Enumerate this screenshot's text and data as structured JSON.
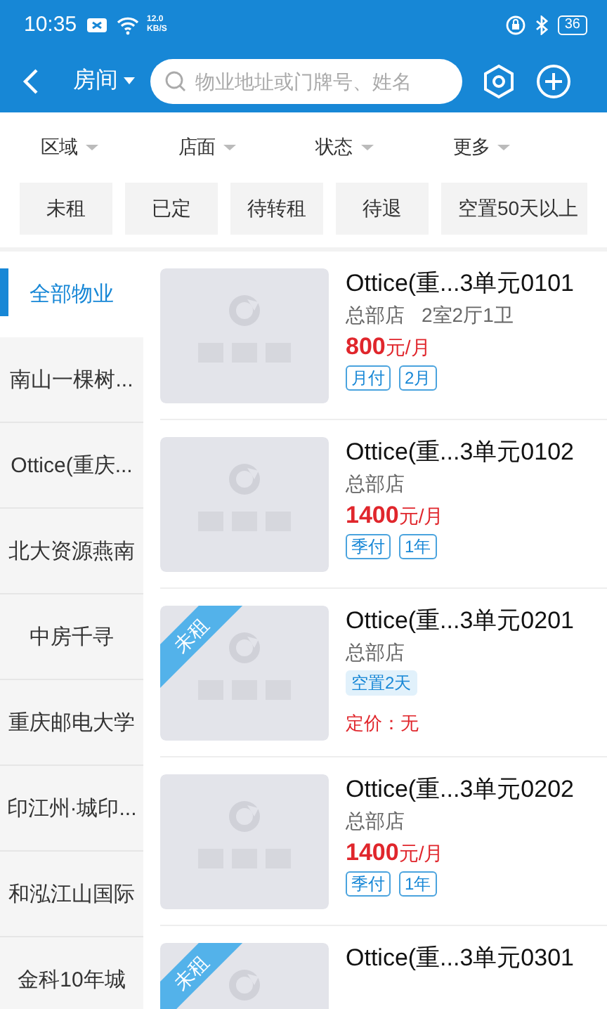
{
  "status_bar": {
    "time": "10:35",
    "speed": "12.0",
    "speed_unit": "KB/S",
    "battery": "36"
  },
  "header": {
    "title": "房间",
    "search": {
      "placeholder": "物业地址或门牌号、姓名"
    }
  },
  "filters": [
    "区域",
    "店面",
    "状态",
    "更多"
  ],
  "chips": [
    "未租",
    "已定",
    "待转租",
    "待退",
    "空置50天以上"
  ],
  "sidebar": {
    "items": [
      {
        "label": "全部物业",
        "selected": true
      },
      {
        "label": "南山一棵树...",
        "selected": false
      },
      {
        "label": "Ottice(重庆...",
        "selected": false
      },
      {
        "label": "北大资源燕南",
        "selected": false
      },
      {
        "label": "中房千寻",
        "selected": false
      },
      {
        "label": "重庆邮电大学",
        "selected": false
      },
      {
        "label": "印江州·城印...",
        "selected": false
      },
      {
        "label": "和泓江山国际",
        "selected": false
      },
      {
        "label": "金科10年城",
        "selected": false
      }
    ]
  },
  "listings": [
    {
      "title": "Ottice(重...3单元0101",
      "store": "总部店",
      "layout": "2室2厅1卫",
      "price": "800",
      "price_unit": "元/月",
      "tags": [
        {
          "text": "月付",
          "kind": "outline"
        },
        {
          "text": "2月",
          "kind": "outline"
        }
      ]
    },
    {
      "title": "Ottice(重...3单元0102",
      "store": "总部店",
      "price": "1400",
      "price_unit": "元/月",
      "tags": [
        {
          "text": "季付",
          "kind": "outline"
        },
        {
          "text": "1年",
          "kind": "outline"
        }
      ]
    },
    {
      "title": "Ottice(重...3单元0201",
      "store": "总部店",
      "ribbon": "未租",
      "tags": [
        {
          "text": "空置2天",
          "kind": "filled"
        }
      ],
      "note": "定价：无"
    },
    {
      "title": "Ottice(重...3单元0202",
      "store": "总部店",
      "price": "1400",
      "price_unit": "元/月",
      "tags": [
        {
          "text": "季付",
          "kind": "outline"
        },
        {
          "text": "1年",
          "kind": "outline"
        }
      ]
    },
    {
      "title": "Ottice(重...3单元0301",
      "ribbon": "未租"
    }
  ]
}
